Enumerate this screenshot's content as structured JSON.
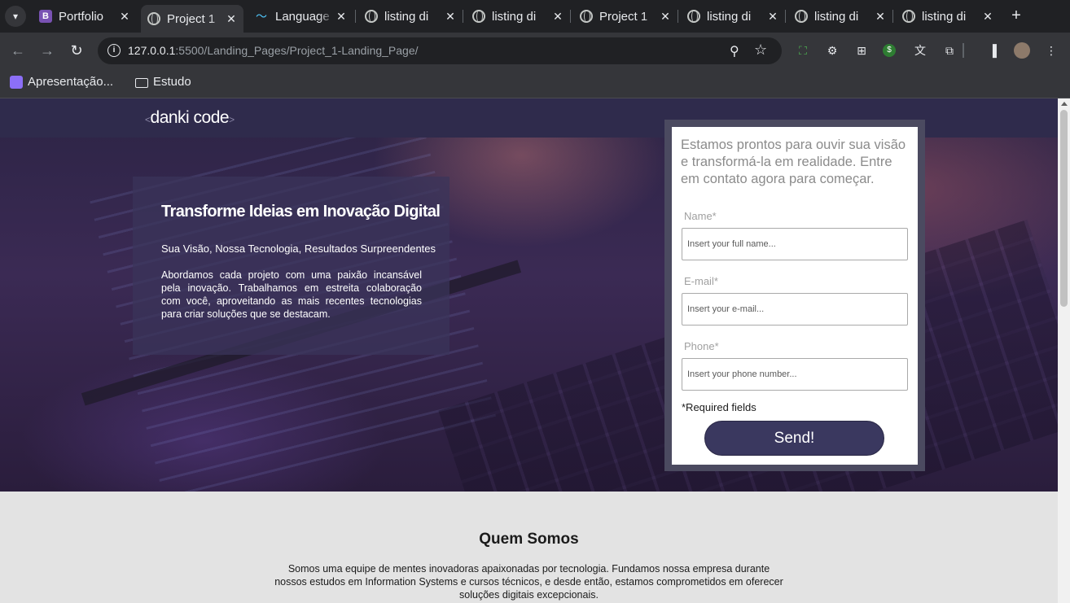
{
  "browser": {
    "tabs": [
      {
        "title": "Portfolio",
        "favicon": "bootstrap-icon",
        "active": false
      },
      {
        "title": "Project 1",
        "favicon": "globe-icon",
        "active": true
      },
      {
        "title": "Language",
        "favicon": "wave-icon",
        "active": false
      },
      {
        "title": "listing di",
        "favicon": "globe-icon",
        "active": false
      },
      {
        "title": "listing di",
        "favicon": "globe-icon",
        "active": false
      },
      {
        "title": "Project 1",
        "favicon": "globe-icon",
        "active": false
      },
      {
        "title": "listing di",
        "favicon": "globe-icon",
        "active": false
      },
      {
        "title": "listing di",
        "favicon": "globe-icon",
        "active": false
      },
      {
        "title": "listing di",
        "favicon": "globe-icon",
        "active": false
      }
    ],
    "url_host": "127.0.0.1",
    "url_rest": ":5500/Landing_Pages/Project_1-Landing_Page/",
    "bookmarks": [
      {
        "label": "Apresentação...",
        "icon": "app-icon"
      },
      {
        "label": "Estudo",
        "icon": "folder-icon"
      }
    ]
  },
  "page": {
    "logo": {
      "left": "<",
      "text": "danki code",
      "right": ">"
    },
    "intro": {
      "title": "Transforme Ideias em Inovação Digital",
      "subtitle": "Sua Visão, Nossa Tecnologia, Resultados Surpreendentes",
      "body": "Abordamos cada projeto com uma paixão incansável pela inovação. Trabalhamos em estreita colaboração com você, aproveitando as mais recentes tecnologias para criar soluções que se destacam."
    },
    "form": {
      "lead": "Estamos prontos para ouvir sua visão e transformá-la em realidade. Entre em contato agora para começar.",
      "name_label": "Name*",
      "name_placeholder": "Insert your full name...",
      "email_label": "E-mail*",
      "email_placeholder": "Insert your e-mail...",
      "phone_label": "Phone*",
      "phone_placeholder": "Insert your phone number...",
      "required_note": "*Required fields",
      "submit_label": "Send!"
    },
    "about": {
      "title": "Quem Somos",
      "text": "Somos uma equipe de mentes inovadoras apaixonadas por tecnologia. Fundamos nossa empresa durante nossos estudos em Information Systems e cursos técnicos, e desde então, estamos comprometidos em oferecer soluções digitais excepcionais."
    }
  },
  "colors": {
    "header_bar": "#2f2b4c",
    "intro_box": "#3a355a",
    "form_frame": "#4b4a60",
    "send_button": "#3a385f",
    "about_bg": "#e3e3e3"
  }
}
